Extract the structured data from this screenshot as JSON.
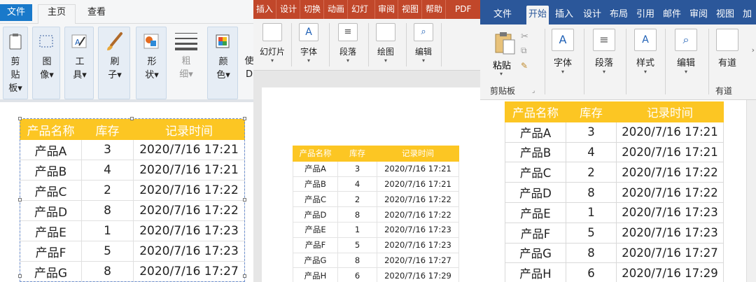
{
  "paint": {
    "tabs": [
      "文件",
      "主页",
      "查看"
    ],
    "groups": [
      {
        "label": "剪贴板",
        "icon": "clipboard-icon"
      },
      {
        "label": "图像",
        "icon": "select-icon"
      },
      {
        "label": "工具",
        "icon": "tools-icon"
      },
      {
        "label": "刷子",
        "icon": "brush-icon"
      },
      {
        "label": "形状",
        "icon": "shapes-icon"
      },
      {
        "label": "粗细",
        "icon": "line-weight-icon"
      },
      {
        "label": "颜色",
        "icon": "palette-icon"
      },
      {
        "label": "使D",
        "icon": ""
      }
    ]
  },
  "ppt": {
    "tabs": [
      "插入",
      "设计",
      "切换",
      "动画",
      "幻灯片",
      "审阅",
      "视图",
      "帮助",
      "PDF工"
    ],
    "groups": [
      {
        "label": "幻灯片",
        "icon": "slide-icon"
      },
      {
        "label": "字体",
        "icon": "font-icon"
      },
      {
        "label": "段落",
        "icon": "paragraph-icon"
      },
      {
        "label": "绘图",
        "icon": "drawing-icon"
      },
      {
        "label": "编辑",
        "icon": "search-icon"
      }
    ]
  },
  "word": {
    "tabs": [
      "文件",
      "开始",
      "插入",
      "设计",
      "布局",
      "引用",
      "邮件",
      "审阅",
      "视图",
      "加"
    ],
    "groups": [
      {
        "label": "粘贴",
        "icon": "paste-icon"
      },
      {
        "label": "字体",
        "icon": "font-icon"
      },
      {
        "label": "段落",
        "icon": "paragraph-icon"
      },
      {
        "label": "样式",
        "icon": "styles-icon"
      },
      {
        "label": "编辑",
        "icon": "search-icon"
      },
      {
        "label": "有道",
        "icon": "youdao-icon"
      }
    ],
    "clipboard_label": "剪贴板",
    "youdao_label": "有道"
  },
  "table": {
    "headers": [
      "产品名称",
      "库存",
      "记录时间"
    ],
    "rows": [
      [
        "产品A",
        "3",
        "2020/7/16 17:21"
      ],
      [
        "产品B",
        "4",
        "2020/7/16 17:21"
      ],
      [
        "产品C",
        "2",
        "2020/7/16 17:22"
      ],
      [
        "产品D",
        "8",
        "2020/7/16 17:22"
      ],
      [
        "产品E",
        "1",
        "2020/7/16 17:23"
      ],
      [
        "产品F",
        "5",
        "2020/7/16 17:23"
      ],
      [
        "产品G",
        "8",
        "2020/7/16 17:27"
      ],
      [
        "产品H",
        "6",
        "2020/7/16 17:29"
      ]
    ]
  },
  "colors": {
    "header_bg": "#fcc623",
    "paint_file": "#1979ca",
    "ppt_ribbon": "#c1472a",
    "word_ribbon": "#2b579a"
  }
}
